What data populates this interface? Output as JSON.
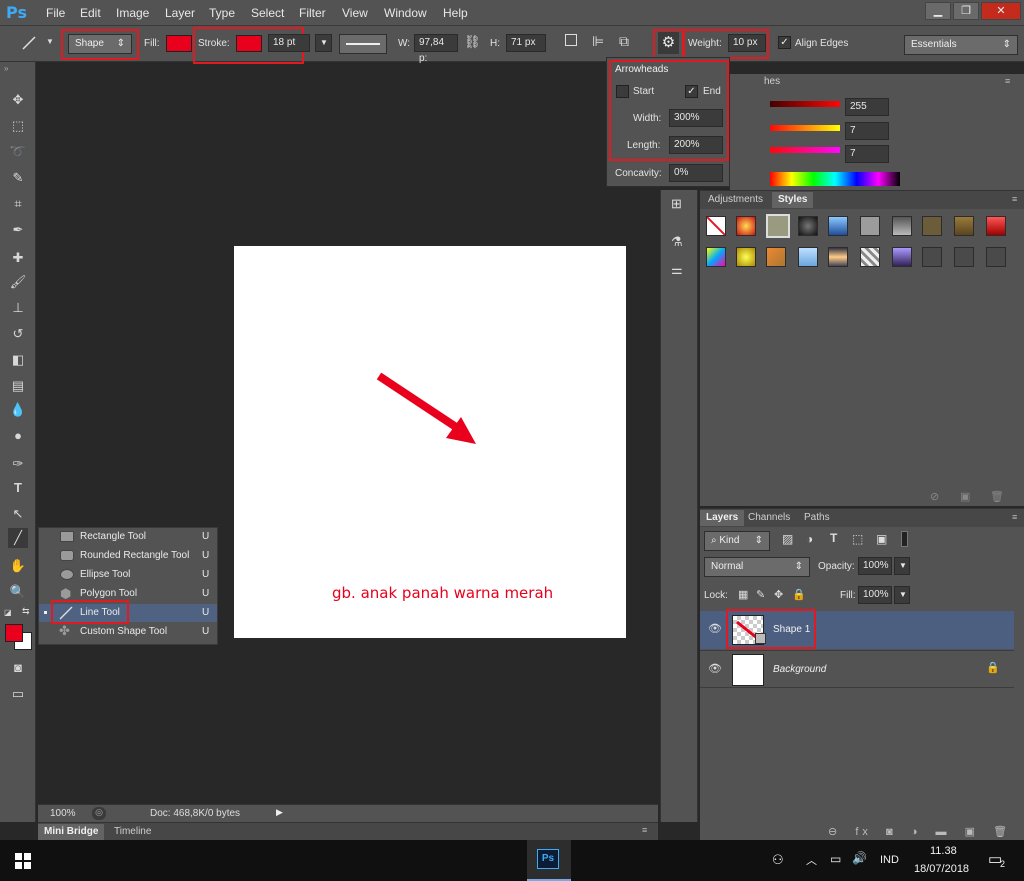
{
  "app": {
    "logo": "Ps"
  },
  "menu": [
    "File",
    "Edit",
    "Image",
    "Layer",
    "Type",
    "Select",
    "Filter",
    "View",
    "Window",
    "Help"
  ],
  "window_controls": {
    "minimize": "▁",
    "restore": "❐",
    "close": "✕"
  },
  "options": {
    "mode": "Shape",
    "fill_label": "Fill:",
    "stroke_label": "Stroke:",
    "stroke_width": "18 pt",
    "w_label": "W:",
    "w_value": "97,84 p:",
    "h_label": "H:",
    "h_value": "71 px",
    "weight_label": "Weight:",
    "weight_value": "10 px",
    "align_edges": "Align Edges",
    "workspace": "Essentials",
    "stroke_color": "#e8001c",
    "fill_color": "#e8001c"
  },
  "arrowheads": {
    "title": "Arrowheads",
    "start_label": "Start",
    "end_label": "End",
    "width_label": "Width:",
    "width_value": "300%",
    "length_label": "Length:",
    "length_value": "200%",
    "concavity_label": "Concavity:",
    "concavity_value": "0%"
  },
  "color_panel": {
    "tab_partial": "hes",
    "values": [
      "255",
      "7",
      "7"
    ]
  },
  "styles_panel": {
    "tabs": [
      "Adjustments",
      "Styles"
    ]
  },
  "flyout": {
    "items": [
      {
        "label": "Rectangle Tool",
        "key": "U"
      },
      {
        "label": "Rounded Rectangle Tool",
        "key": "U"
      },
      {
        "label": "Ellipse Tool",
        "key": "U"
      },
      {
        "label": "Polygon Tool",
        "key": "U"
      },
      {
        "label": "Line Tool",
        "key": "U"
      },
      {
        "label": "Custom Shape Tool",
        "key": "U"
      }
    ]
  },
  "canvas": {
    "caption": "gb. anak panah warna merah",
    "arrow_color": "#e8001c"
  },
  "layers_panel": {
    "tabs": [
      "Layers",
      "Channels",
      "Paths"
    ],
    "kind": "Kind",
    "blend_mode": "Normal",
    "opacity_label": "Opacity:",
    "opacity_value": "100%",
    "lock_label": "Lock:",
    "fill_label": "Fill:",
    "fill_value": "100%",
    "layers": [
      {
        "name": "Shape 1"
      },
      {
        "name": "Background"
      }
    ],
    "footer_icons": "⊖  fx  ◙  ◑  ▬  ▣  🗑"
  },
  "status": {
    "zoom": "100%",
    "doc": "Doc: 468,8K/0 bytes"
  },
  "bottom_tabs": [
    "Mini Bridge",
    "Timeline"
  ],
  "taskbar": {
    "app": "Ps",
    "lang": "IND",
    "time": "11.38",
    "date": "18/07/2018",
    "notif_count": "2"
  }
}
